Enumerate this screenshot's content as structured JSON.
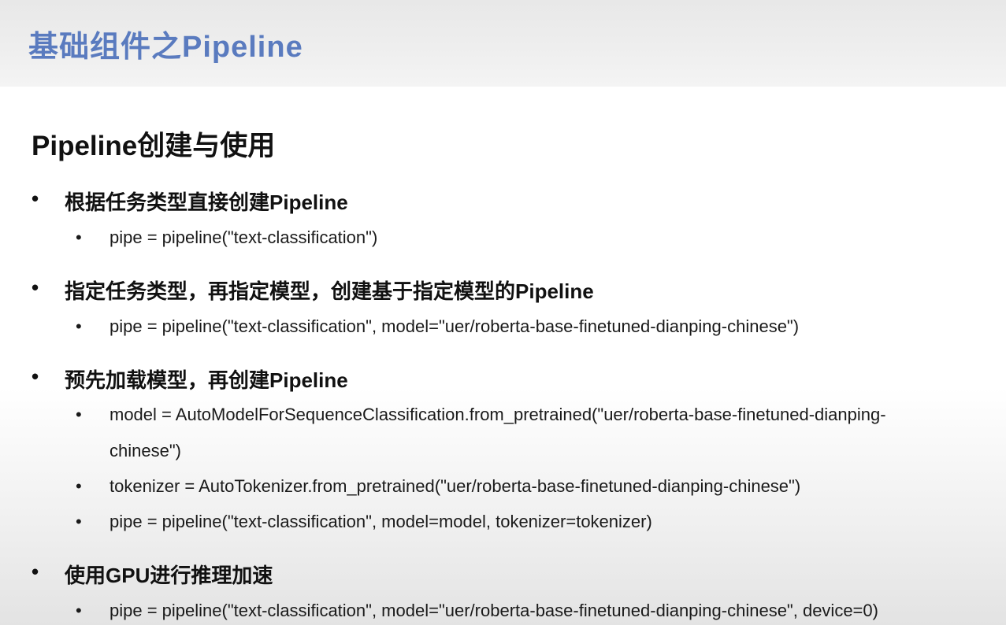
{
  "slide": {
    "title": "基础组件之Pipeline",
    "section_heading": "Pipeline创建与使用",
    "bullet_glyph": "•",
    "bullets": [
      {
        "text": "根据任务类型直接创建Pipeline",
        "sub": [
          {
            "text": "pipe = pipeline(\"text-classification\")"
          }
        ]
      },
      {
        "text": "指定任务类型，再指定模型，创建基于指定模型的Pipeline",
        "sub": [
          {
            "text": "pipe = pipeline(\"text-classification\", model=\"uer/roberta-base-finetuned-dianping-chinese\")"
          }
        ]
      },
      {
        "text": "预先加载模型，再创建Pipeline",
        "sub": [
          {
            "text": "model = AutoModelForSequenceClassification.from_pretrained(\"uer/roberta-base-finetuned-dianping-",
            "continuation": "chinese\")"
          },
          {
            "text": "tokenizer = AutoTokenizer.from_pretrained(\"uer/roberta-base-finetuned-dianping-chinese\")"
          },
          {
            "text": "pipe = pipeline(\"text-classification\", model=model, tokenizer=tokenizer)"
          }
        ]
      },
      {
        "text": "使用GPU进行推理加速",
        "sub": [
          {
            "text": "pipe = pipeline(\"text-classification\", model=\"uer/roberta-base-finetuned-dianping-chinese\", device=0)"
          }
        ]
      }
    ]
  }
}
